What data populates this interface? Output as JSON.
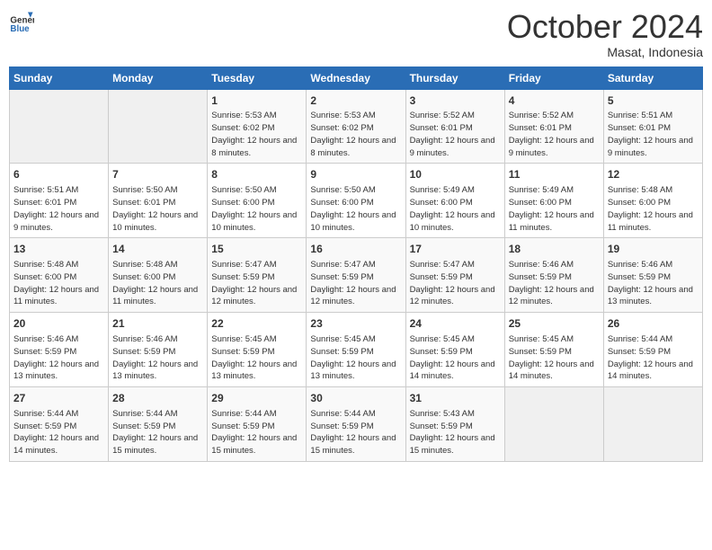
{
  "header": {
    "logo_line1": "General",
    "logo_line2": "Blue",
    "month": "October 2024",
    "location": "Masat, Indonesia"
  },
  "weekdays": [
    "Sunday",
    "Monday",
    "Tuesday",
    "Wednesday",
    "Thursday",
    "Friday",
    "Saturday"
  ],
  "weeks": [
    [
      {
        "day": "",
        "empty": true
      },
      {
        "day": "",
        "empty": true
      },
      {
        "day": "1",
        "sunrise": "Sunrise: 5:53 AM",
        "sunset": "Sunset: 6:02 PM",
        "daylight": "Daylight: 12 hours and 8 minutes."
      },
      {
        "day": "2",
        "sunrise": "Sunrise: 5:53 AM",
        "sunset": "Sunset: 6:02 PM",
        "daylight": "Daylight: 12 hours and 8 minutes."
      },
      {
        "day": "3",
        "sunrise": "Sunrise: 5:52 AM",
        "sunset": "Sunset: 6:01 PM",
        "daylight": "Daylight: 12 hours and 9 minutes."
      },
      {
        "day": "4",
        "sunrise": "Sunrise: 5:52 AM",
        "sunset": "Sunset: 6:01 PM",
        "daylight": "Daylight: 12 hours and 9 minutes."
      },
      {
        "day": "5",
        "sunrise": "Sunrise: 5:51 AM",
        "sunset": "Sunset: 6:01 PM",
        "daylight": "Daylight: 12 hours and 9 minutes."
      }
    ],
    [
      {
        "day": "6",
        "sunrise": "Sunrise: 5:51 AM",
        "sunset": "Sunset: 6:01 PM",
        "daylight": "Daylight: 12 hours and 9 minutes."
      },
      {
        "day": "7",
        "sunrise": "Sunrise: 5:50 AM",
        "sunset": "Sunset: 6:01 PM",
        "daylight": "Daylight: 12 hours and 10 minutes."
      },
      {
        "day": "8",
        "sunrise": "Sunrise: 5:50 AM",
        "sunset": "Sunset: 6:00 PM",
        "daylight": "Daylight: 12 hours and 10 minutes."
      },
      {
        "day": "9",
        "sunrise": "Sunrise: 5:50 AM",
        "sunset": "Sunset: 6:00 PM",
        "daylight": "Daylight: 12 hours and 10 minutes."
      },
      {
        "day": "10",
        "sunrise": "Sunrise: 5:49 AM",
        "sunset": "Sunset: 6:00 PM",
        "daylight": "Daylight: 12 hours and 10 minutes."
      },
      {
        "day": "11",
        "sunrise": "Sunrise: 5:49 AM",
        "sunset": "Sunset: 6:00 PM",
        "daylight": "Daylight: 12 hours and 11 minutes."
      },
      {
        "day": "12",
        "sunrise": "Sunrise: 5:48 AM",
        "sunset": "Sunset: 6:00 PM",
        "daylight": "Daylight: 12 hours and 11 minutes."
      }
    ],
    [
      {
        "day": "13",
        "sunrise": "Sunrise: 5:48 AM",
        "sunset": "Sunset: 6:00 PM",
        "daylight": "Daylight: 12 hours and 11 minutes."
      },
      {
        "day": "14",
        "sunrise": "Sunrise: 5:48 AM",
        "sunset": "Sunset: 6:00 PM",
        "daylight": "Daylight: 12 hours and 11 minutes."
      },
      {
        "day": "15",
        "sunrise": "Sunrise: 5:47 AM",
        "sunset": "Sunset: 5:59 PM",
        "daylight": "Daylight: 12 hours and 12 minutes."
      },
      {
        "day": "16",
        "sunrise": "Sunrise: 5:47 AM",
        "sunset": "Sunset: 5:59 PM",
        "daylight": "Daylight: 12 hours and 12 minutes."
      },
      {
        "day": "17",
        "sunrise": "Sunrise: 5:47 AM",
        "sunset": "Sunset: 5:59 PM",
        "daylight": "Daylight: 12 hours and 12 minutes."
      },
      {
        "day": "18",
        "sunrise": "Sunrise: 5:46 AM",
        "sunset": "Sunset: 5:59 PM",
        "daylight": "Daylight: 12 hours and 12 minutes."
      },
      {
        "day": "19",
        "sunrise": "Sunrise: 5:46 AM",
        "sunset": "Sunset: 5:59 PM",
        "daylight": "Daylight: 12 hours and 13 minutes."
      }
    ],
    [
      {
        "day": "20",
        "sunrise": "Sunrise: 5:46 AM",
        "sunset": "Sunset: 5:59 PM",
        "daylight": "Daylight: 12 hours and 13 minutes."
      },
      {
        "day": "21",
        "sunrise": "Sunrise: 5:46 AM",
        "sunset": "Sunset: 5:59 PM",
        "daylight": "Daylight: 12 hours and 13 minutes."
      },
      {
        "day": "22",
        "sunrise": "Sunrise: 5:45 AM",
        "sunset": "Sunset: 5:59 PM",
        "daylight": "Daylight: 12 hours and 13 minutes."
      },
      {
        "day": "23",
        "sunrise": "Sunrise: 5:45 AM",
        "sunset": "Sunset: 5:59 PM",
        "daylight": "Daylight: 12 hours and 13 minutes."
      },
      {
        "day": "24",
        "sunrise": "Sunrise: 5:45 AM",
        "sunset": "Sunset: 5:59 PM",
        "daylight": "Daylight: 12 hours and 14 minutes."
      },
      {
        "day": "25",
        "sunrise": "Sunrise: 5:45 AM",
        "sunset": "Sunset: 5:59 PM",
        "daylight": "Daylight: 12 hours and 14 minutes."
      },
      {
        "day": "26",
        "sunrise": "Sunrise: 5:44 AM",
        "sunset": "Sunset: 5:59 PM",
        "daylight": "Daylight: 12 hours and 14 minutes."
      }
    ],
    [
      {
        "day": "27",
        "sunrise": "Sunrise: 5:44 AM",
        "sunset": "Sunset: 5:59 PM",
        "daylight": "Daylight: 12 hours and 14 minutes."
      },
      {
        "day": "28",
        "sunrise": "Sunrise: 5:44 AM",
        "sunset": "Sunset: 5:59 PM",
        "daylight": "Daylight: 12 hours and 15 minutes."
      },
      {
        "day": "29",
        "sunrise": "Sunrise: 5:44 AM",
        "sunset": "Sunset: 5:59 PM",
        "daylight": "Daylight: 12 hours and 15 minutes."
      },
      {
        "day": "30",
        "sunrise": "Sunrise: 5:44 AM",
        "sunset": "Sunset: 5:59 PM",
        "daylight": "Daylight: 12 hours and 15 minutes."
      },
      {
        "day": "31",
        "sunrise": "Sunrise: 5:43 AM",
        "sunset": "Sunset: 5:59 PM",
        "daylight": "Daylight: 12 hours and 15 minutes."
      },
      {
        "day": "",
        "empty": true
      },
      {
        "day": "",
        "empty": true
      }
    ]
  ]
}
